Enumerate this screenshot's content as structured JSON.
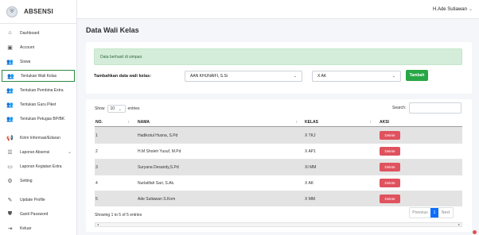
{
  "brand": {
    "name": "ABSENSI",
    "logo_icon": "shield-logo"
  },
  "sidebar": {
    "items": [
      {
        "label": "Dashboard",
        "icon": "home-icon",
        "glyph": "⌂"
      },
      {
        "label": "Account",
        "icon": "id-card-icon",
        "glyph": "▣"
      },
      {
        "label": "Siswa",
        "icon": "users-icon",
        "glyph": "👥"
      },
      {
        "label": "Tentukan Wali Kelas",
        "icon": "user-cog-icon",
        "glyph": "👥",
        "active": true
      },
      {
        "label": "Tentukan Pembina Extra",
        "icon": "user-cog-icon",
        "glyph": "👥"
      },
      {
        "label": "Tentukan Guru Piket",
        "icon": "user-cog-icon",
        "glyph": "👥"
      },
      {
        "label": "Tentukan Petugas BP/BK",
        "icon": "user-cog-icon",
        "glyph": "👥"
      },
      {
        "label": "Kirim Informasi/Edaran",
        "icon": "megaphone-icon",
        "glyph": "📢"
      },
      {
        "label": "Laporan Absensi",
        "icon": "list-icon",
        "glyph": "☰",
        "has_caret": true
      },
      {
        "label": "Laporan Kegiatan Extra",
        "icon": "image-icon",
        "glyph": "▭"
      },
      {
        "label": "Setting",
        "icon": "gear-icon",
        "glyph": "⚙"
      },
      {
        "label": "Update Profile",
        "icon": "user-edit-icon",
        "glyph": "✎"
      },
      {
        "label": "Ganti Password",
        "icon": "shield-icon",
        "glyph": "⛊"
      },
      {
        "label": "Keluar",
        "icon": "logout-icon",
        "glyph": "⇥"
      }
    ]
  },
  "topbar": {
    "user_name": "H.Ade Sutiawan",
    "caret": "⌄"
  },
  "page": {
    "title": "Data Wali Kelas"
  },
  "form": {
    "alert_text": "Data berhasil di simpan.",
    "label": "Tambahkan data wali kelas:",
    "teacher_select": "AAN KHUNAIFI, S.Si",
    "class_select": "X AK",
    "add_button": "Tambah"
  },
  "table_controls": {
    "show_prefix": "Show",
    "show_value": "10",
    "show_suffix": "entries",
    "search_label": "Search:"
  },
  "table": {
    "headers": {
      "no": "NO.",
      "nama": "NAMA",
      "kelas": "KELAS",
      "aksi": "AKSI"
    },
    "rows": [
      {
        "no": "1",
        "nama": "Hadikotul Husna, S.Pd",
        "kelas": "X TKJ",
        "aksi": "Delete"
      },
      {
        "no": "2",
        "nama": "H.M Sholeh Yusuf, M.Pd",
        "kelas": "X AP1",
        "aksi": "Delete"
      },
      {
        "no": "3",
        "nama": "Suryana Desandy,S.Pd",
        "kelas": "XI MM",
        "aksi": "Delete"
      },
      {
        "no": "4",
        "nama": "Nurlatifah Sari, S.Ak.",
        "kelas": "X AK",
        "aksi": "Delete"
      },
      {
        "no": "5",
        "nama": "Ade Sutiawan S.Kom",
        "kelas": "X MM",
        "aksi": "Delete"
      }
    ]
  },
  "footer": {
    "info": "Showing 1 to 5 of 5 entries",
    "previous": "Previous",
    "current_page": "1",
    "next": "Next"
  },
  "colors": {
    "success": "#28a745",
    "danger": "#e0525e",
    "primary": "#0d6efd",
    "alert_bg": "#d4edda"
  }
}
